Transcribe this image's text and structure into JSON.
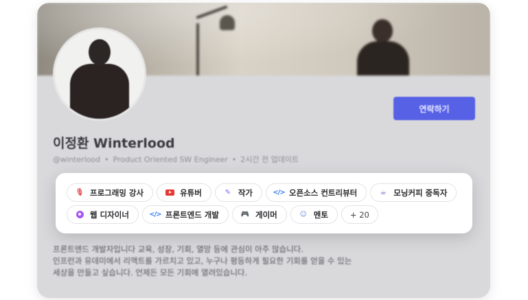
{
  "profile": {
    "name": "이정환 Winterlood",
    "handle": "@winterlood",
    "role": "Product Oriented SW Engineer",
    "updated": "2시간 전 업데이트",
    "contact_label": "연락하기",
    "bio_lines": [
      "프론트엔드 개발자입니다 교육, 성장, 기회, 열망 등에 관심이 아주 많습니다.",
      "인프런과 유데미에서 리액트를 가르치고 있고, 누구나 평등하게 필요한 기회를 얻을 수 있는",
      "세상을 만들고 싶습니다. 언제든 모든 기회에 열려있습니다."
    ]
  },
  "tags_row1": [
    {
      "label": "프로그래밍 강사",
      "icon": "microphone-icon"
    },
    {
      "label": "유튜버",
      "icon": "youtube-icon"
    },
    {
      "label": "작가",
      "icon": "pen-icon"
    },
    {
      "label": "오픈소스 컨트리뷰터",
      "icon": "code-icon"
    },
    {
      "label": "모닝커피 중독자",
      "icon": "coffee-icon"
    }
  ],
  "tags_row2": [
    {
      "label": "웹 디자이너",
      "icon": "palette-icon"
    },
    {
      "label": "프론트엔드 개발",
      "icon": "code-icon"
    },
    {
      "label": "게이머",
      "icon": "gamepad-icon"
    },
    {
      "label": "멘토",
      "icon": "mentor-icon"
    }
  ],
  "more_tags_label": "+ 20",
  "colors": {
    "accent": "#5761e6",
    "card_bg": "#d9d9dc",
    "panel_bg": "#ffffff"
  }
}
